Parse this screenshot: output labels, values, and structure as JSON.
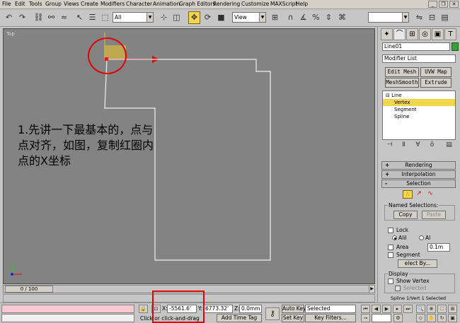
{
  "menu": [
    "File",
    "Edit",
    "Tools",
    "Group",
    "Views",
    "Create",
    "Modifiers",
    "Character",
    "Animation",
    "Graph Editors",
    "Rendering",
    "Customize",
    "MAXScript",
    "Help"
  ],
  "toolbar": {
    "selection_filter": "All",
    "ref_coord": "View"
  },
  "viewport": {
    "label": "Top",
    "annotation_lines": [
      "1.先讲一下最基本的，点与",
      "点对齐，如图，复制红圈内",
      "点的X坐标"
    ]
  },
  "timeslider": {
    "label": "0 / 100"
  },
  "status": {
    "x_label": "X:",
    "x_value": "-5561.6'",
    "y_label": "Y:",
    "y_value": "6773.32'",
    "z_label": "Z:",
    "z_value": "0.0mm",
    "auto_key": "Auto Key",
    "selected": "Selected",
    "set_key": "Set Key",
    "key_filters": "Key Filters...",
    "prompt": "Click or click-and-drag",
    "add_time_tag": "Add Time Tag"
  },
  "panel": {
    "object_name": "Line01",
    "object_color": "#2fa82f",
    "modifier_list": "Modifier List",
    "buttons": [
      "Edit Mesh",
      "UVW Map",
      "MeshSmooth",
      "Extrude"
    ],
    "stack": {
      "root": "Line",
      "items": [
        "Vertex",
        "Segment",
        "Spline"
      ]
    },
    "rollouts": {
      "rendering": "Rendering",
      "interpolation": "Interpolation",
      "selection": "Selection"
    },
    "named_selections": {
      "title": "Named Selections:",
      "copy": "Copy",
      "paste": "Paste"
    },
    "lock": "Lock",
    "radio1": "Alil",
    "radio2": "Al",
    "area": "Area",
    "area_value": "0.1m",
    "segment": "Segment",
    "select_by": "elect By...",
    "display": {
      "title": "Display",
      "show_vertex": "Show Vertex",
      "selected": "Selected"
    },
    "status_line": "Spline 1/Vert 1 Selected"
  },
  "colors": {
    "highlight": "#f2d64c",
    "annotation_red": "#e00000",
    "viewport": "#838383"
  }
}
